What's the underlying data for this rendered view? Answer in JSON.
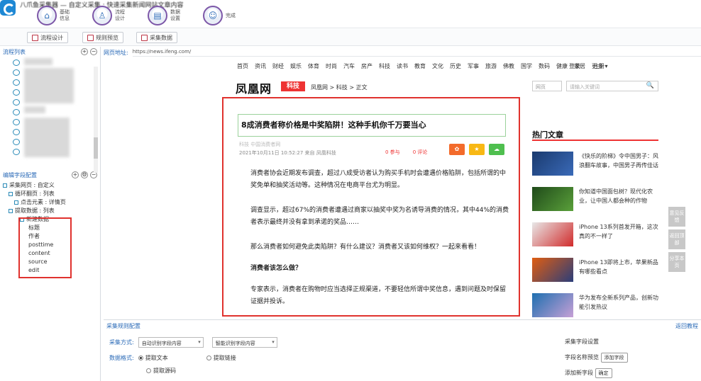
{
  "app": {
    "title": "八爪鱼采集器 — 自定义采集 : 快速采集新闻网站文章内容",
    "main_buttons": [
      {
        "label": "基础信息",
        "icon": "house-icon"
      },
      {
        "label": "流程设计",
        "icon": "user-icon"
      },
      {
        "label": "数据设置",
        "icon": "database-icon"
      },
      {
        "label": "完成",
        "icon": "person-icon"
      }
    ],
    "tabs": [
      "流程设计",
      "规则预览",
      "采集数据"
    ]
  },
  "left_panel": {
    "header": "流程列表",
    "section2_header": "编辑字段配置",
    "tree": [
      {
        "label": "采集网页 : 自定义",
        "level": 0
      },
      {
        "label": "循环翻页 : 列表",
        "level": 1
      },
      {
        "label": "点击元素 : 详情页",
        "level": 2
      },
      {
        "label": "提取数据 : 列表",
        "level": 1
      },
      {
        "label": "新建数据",
        "level": 2
      }
    ],
    "fields": [
      "标题",
      "作者",
      "posttime",
      "content",
      "source",
      "edit"
    ]
  },
  "url_bar": {
    "label": "网页地址:",
    "value": "https://news.ifeng.com/"
  },
  "site": {
    "nav": [
      "首页",
      "资讯",
      "财经",
      "娱乐",
      "体育",
      "时尚",
      "汽车",
      "房产",
      "科技",
      "读书",
      "教育",
      "文化",
      "历史",
      "军事",
      "旅游",
      "佛教",
      "国学",
      "数码",
      "健康",
      "家居"
    ],
    "more": "更多 ▾",
    "login": "登录",
    "register": "注册",
    "brand": "凤凰网",
    "brand_badge": "科技",
    "breadcrumb": "凤凰网 > 科技 > 正文",
    "search_select": "网页",
    "search_placeholder": "请输入关键词",
    "search_btn": "🔍",
    "article": {
      "title": "8成消费者称价格是中奖陷阱！这种手机你千万要当心",
      "meta": "2021年10月11日 10:52:27 来自 凤凰科技",
      "meta_small": "科技  中国消费者网",
      "stats": [
        "0 参与",
        "0 评论"
      ],
      "paragraphs": [
        "消费者协会近期发布调查，超过八成受访者认为购买手机时会遭遇价格陷阱，包括所谓的中奖免单和抽奖活动等。这种情况在电商平台尤为明显。",
        "调查显示，超过67%的消费者遭遇过商家以抽奖中奖为名诱导消费的情况，其中44%的消费者表示最终并没有拿到承诺的奖品……",
        "那么消费者如何避免此类陷阱？有什么建议？消费者又该如何维权？一起来看看！",
        "消费者该怎么做？",
        "专家表示，消费者在购物时应当选择正规渠道，不要轻信所谓中奖信息，遇到问题及时保留证据并投诉。"
      ]
    },
    "hot_title": "热门文章",
    "hot": [
      {
        "text": "《快乐的阶梯》令中国男子：风浪翻车故事，中国男子再传佳话",
        "color": "#1a3a6e"
      },
      {
        "text": "你知道中国面包树？现代化农业，让中国人都会种的作物",
        "color": "#1f4a1a"
      },
      {
        "text": "iPhone 13系列首发开箱，这次真的不一样了",
        "color": "#d12b2b"
      },
      {
        "text": "iPhone 13即将上市，苹果新品有哪些看点",
        "color": "#e05d12"
      },
      {
        "text": "华为发布全新系列产品，创新功能引发热议",
        "color": "#1e6fb0"
      }
    ],
    "side_tabs": [
      "意见反馈",
      "返回顶部",
      "分享本页"
    ]
  },
  "bottom": {
    "header": "采集规则配置",
    "help": "返回教程",
    "row1_label": "采集方式:",
    "row1_sel1": "自动识别字段内容",
    "row1_sel2": "智能识别字段内容",
    "row2_label": "数据格式:",
    "radio_a": "提取文本",
    "radio_b": "提取链接",
    "radio_c": "提取源码",
    "right_line1": "采集字段设置",
    "right_line2": "字段名称预览",
    "right_line3": "添加新字段",
    "right_btn1": "添加字段",
    "right_btn2": "确定"
  },
  "colors": {
    "accent": "#2a6ab7",
    "highlight": "#e0322e",
    "share_orange": "#f36b2b",
    "share_yellow": "#f8b814",
    "share_green": "#4fbf4f"
  }
}
